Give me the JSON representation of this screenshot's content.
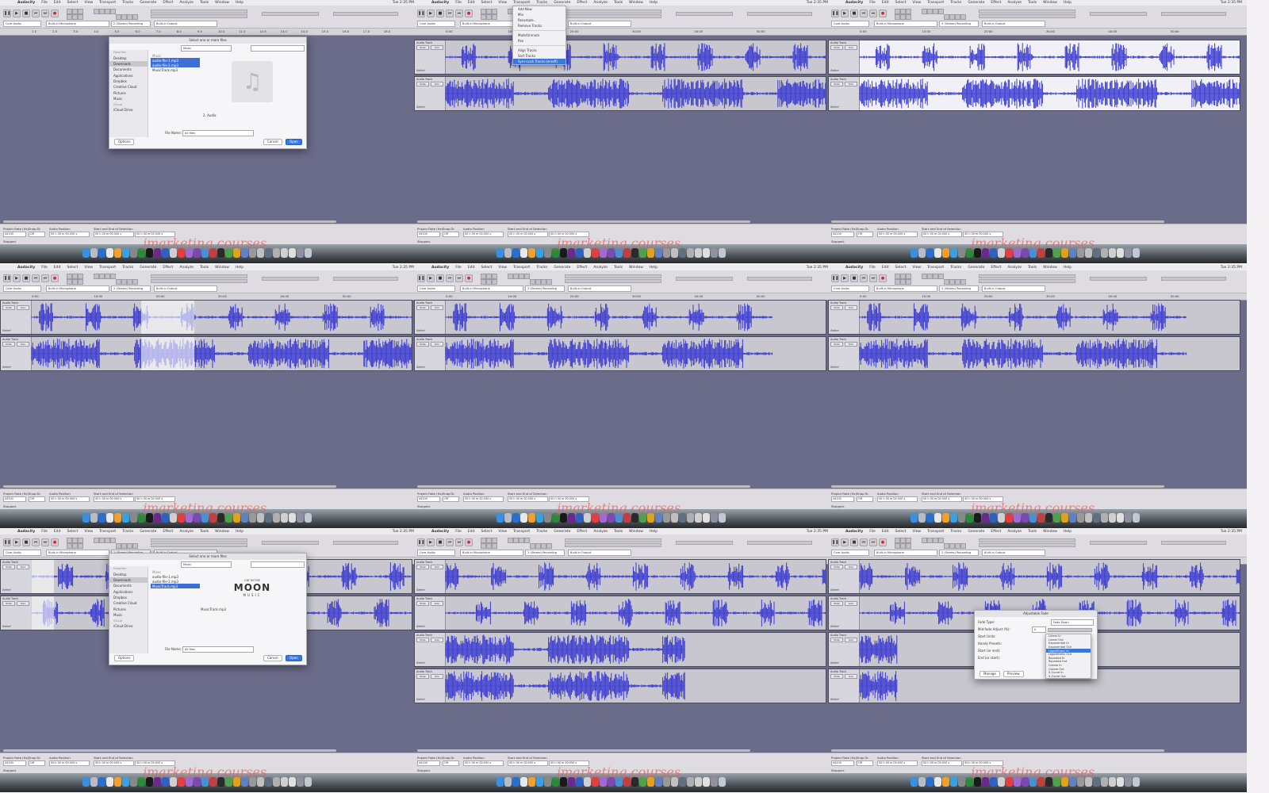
{
  "app": {
    "apple_menu": "",
    "name": "Audacity",
    "menus": [
      "File",
      "Edit",
      "Select",
      "View",
      "Transport",
      "Tracks",
      "Generate",
      "Effect",
      "Analyze",
      "Tools",
      "Window",
      "Help"
    ],
    "clock": "Tue 2:35 PM",
    "transport": [
      "❚❚",
      "▶",
      "■",
      "⏮",
      "⏭",
      "●"
    ],
    "host": "Core Audio",
    "input_device": "Built-in Microphone",
    "output_device": "Built-in Output",
    "channels": "2 (Stereo) Recording"
  },
  "ruler": {
    "ticks_a": [
      "1.0",
      "2.0",
      "3.0",
      "4.0",
      "5.0",
      "6.0",
      "7.0",
      "8.0",
      "9.0",
      "10.0",
      "11.0",
      "12.0",
      "13.0",
      "14.0",
      "15.0",
      "16.0",
      "17.0",
      "18.0"
    ],
    "ticks_b": [
      "0:00",
      "10:00",
      "20:00",
      "30:00",
      "40:00",
      "50:00"
    ],
    "ticks_c": [
      "1:00",
      "1:15",
      "1:30",
      "1:45",
      "2:00",
      "2:15",
      "2:30",
      "2:45",
      "3:00",
      "3:15",
      "3:30",
      "3:45"
    ]
  },
  "track": {
    "name": "Audio Track",
    "mute": "Mute",
    "solo": "Solo",
    "select": "Select"
  },
  "bottom": {
    "project_rate_label": "Project Rate (Hz)",
    "project_rate": "44100",
    "snap_label": "Snap-To",
    "snap": "Off",
    "audio_position_label": "Audio Position",
    "audio_position": "00 h 00 m 00.000 s",
    "selection_label": "Start and End of Selection",
    "selection_start": "00 h 00 m 00.000 s",
    "selection_end": "00 h 00 m 00.000 s",
    "status": "Stopped."
  },
  "open_dialog": {
    "title": "Select one or more files",
    "sidebar_fav_header": "Favorites",
    "sidebar_items": [
      "Desktop",
      "Downloads",
      "Documents",
      "Applications",
      "Dropbox",
      "Creative Cloud",
      "Pictures",
      "Music"
    ],
    "sidebar_icloud_header": "iCloud",
    "sidebar_icloud": "iCloud Drive",
    "folder_header": "Music",
    "files_1": [
      "audio-file-1.mp3",
      "audio-file-2.mp3",
      "MusicTrack.mp3"
    ],
    "files_2": [
      "audio-file-1.mp3",
      "audio-file-2.mp3",
      "MusicTrack.mp3"
    ],
    "preview_name_1": "2. Audio",
    "preview_name_2": "MusicTrack.mp3",
    "format_label": "File Name:",
    "format_value": "All files",
    "options": "Options",
    "cancel": "Cancel",
    "open": "Open",
    "logo_top": "CAT IN THE",
    "logo_main": "MOON",
    "logo_bottom": "MUSIC"
  },
  "tracks_menu": {
    "items": [
      "Add New",
      "Mix",
      "Resample...",
      "Remove Tracks",
      "Mute/Unmute",
      "Pan",
      "Align Tracks",
      "Sort Tracks",
      "Sync-Lock Tracks (on/off)"
    ],
    "highlight_index": 8
  },
  "fade_dialog": {
    "title": "Adjustable Fade",
    "rows": [
      "Fade Type:",
      "Mid-fade Adjust (%):",
      "Start Units:",
      "Handy Presets:",
      "Start (or end):",
      "End (or start):"
    ],
    "fade_type": "Fade Down",
    "mid_fade": "0",
    "preset_options": [
      "Linear In",
      "Linear Out",
      "Exponential In",
      "Exponential Out",
      "Logarithmic In",
      "Logarithmic Out",
      "Rounded In",
      "Rounded Out",
      "Cosine In",
      "Cosine Out",
      "S-Curve In",
      "S-Curve Out"
    ],
    "preset_selected": 4,
    "manage": "Manage",
    "preview": "Preview",
    "ok": "OK"
  },
  "watermark": "jmarketing courses",
  "colors": {
    "desktop": "#6b6b8a",
    "track_bg": "#c8c7cf",
    "wave": "#3a3ad0",
    "selection": "#ffffff",
    "accent": "#3a77dc",
    "record": "#dd2222",
    "watermark": "#e06060"
  }
}
